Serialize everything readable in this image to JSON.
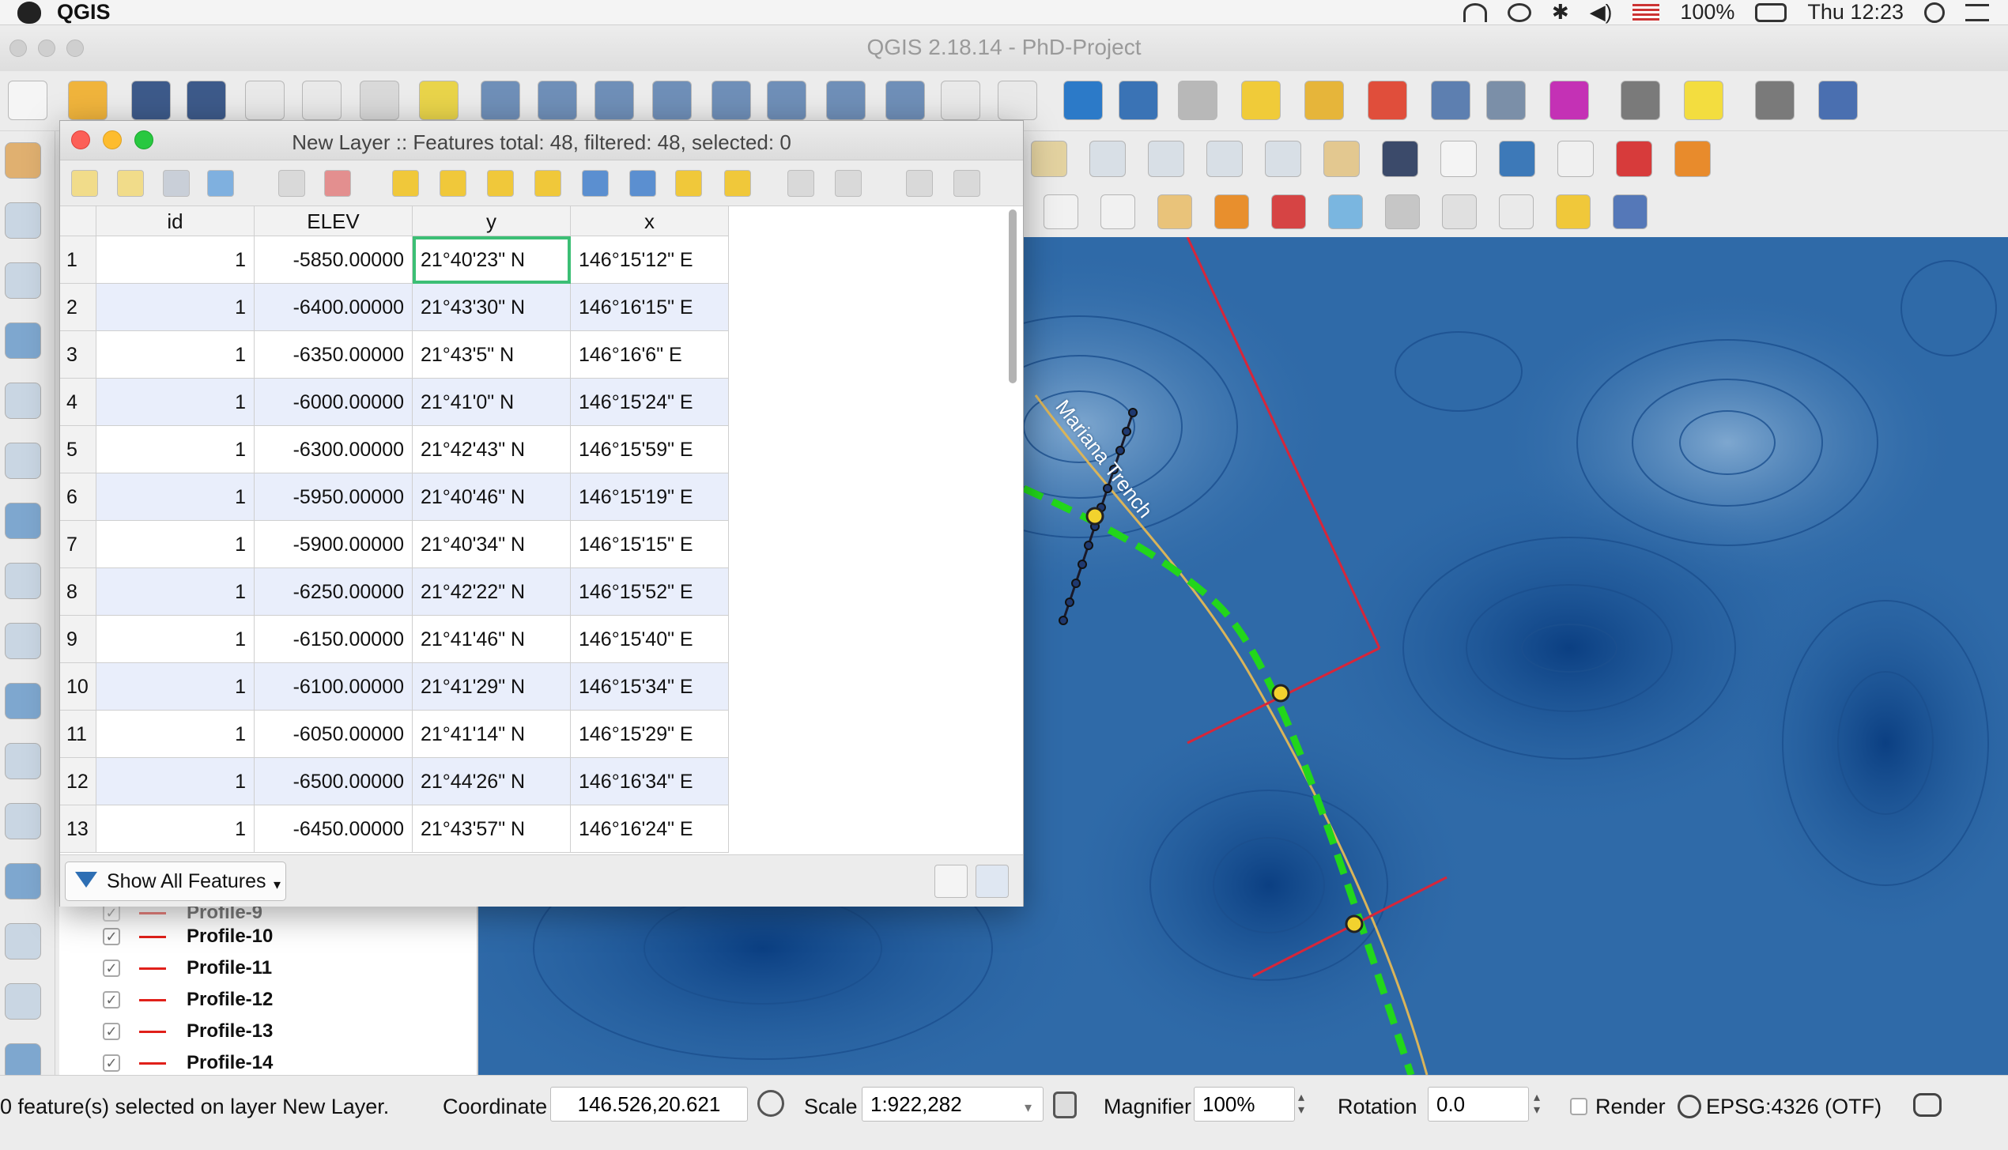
{
  "menubar": {
    "app": "QGIS",
    "battery": "100%",
    "clock": "Thu 12:23"
  },
  "window": {
    "title": "QGIS 2.18.14 - PhD-Project"
  },
  "attribute_table": {
    "title": "New Layer :: Features total: 48, filtered: 48, selected: 0",
    "columns": [
      "id",
      "ELEV",
      "y",
      "x"
    ],
    "rows": [
      {
        "n": "1",
        "id": "1",
        "elev": "-5850.00000",
        "y": "21°40'23\" N",
        "x": "146°15'12\" E"
      },
      {
        "n": "2",
        "id": "1",
        "elev": "-6400.00000",
        "y": "21°43'30\" N",
        "x": "146°16'15\" E"
      },
      {
        "n": "3",
        "id": "1",
        "elev": "-6350.00000",
        "y": "21°43'5\" N",
        "x": "146°16'6\" E"
      },
      {
        "n": "4",
        "id": "1",
        "elev": "-6000.00000",
        "y": "21°41'0\" N",
        "x": "146°15'24\" E"
      },
      {
        "n": "5",
        "id": "1",
        "elev": "-6300.00000",
        "y": "21°42'43\" N",
        "x": "146°15'59\" E"
      },
      {
        "n": "6",
        "id": "1",
        "elev": "-5950.00000",
        "y": "21°40'46\" N",
        "x": "146°15'19\" E"
      },
      {
        "n": "7",
        "id": "1",
        "elev": "-5900.00000",
        "y": "21°40'34\" N",
        "x": "146°15'15\" E"
      },
      {
        "n": "8",
        "id": "1",
        "elev": "-6250.00000",
        "y": "21°42'22\" N",
        "x": "146°15'52\" E"
      },
      {
        "n": "9",
        "id": "1",
        "elev": "-6150.00000",
        "y": "21°41'46\" N",
        "x": "146°15'40\" E"
      },
      {
        "n": "10",
        "id": "1",
        "elev": "-6100.00000",
        "y": "21°41'29\" N",
        "x": "146°15'34\" E"
      },
      {
        "n": "11",
        "id": "1",
        "elev": "-6050.00000",
        "y": "21°41'14\" N",
        "x": "146°15'29\" E"
      },
      {
        "n": "12",
        "id": "1",
        "elev": "-6500.00000",
        "y": "21°44'26\" N",
        "x": "146°16'34\" E"
      },
      {
        "n": "13",
        "id": "1",
        "elev": "-6450.00000",
        "y": "21°43'57\" N",
        "x": "146°16'24\" E"
      }
    ],
    "filter_button": "Show All Features"
  },
  "layers_panel": {
    "items": [
      "Profile-9",
      "Profile-10",
      "Profile-11",
      "Profile-12",
      "Profile-13",
      "Profile-14"
    ]
  },
  "map": {
    "label": "Mariana Trench"
  },
  "statusbar": {
    "message": "0 feature(s) selected on layer New Layer.",
    "coordinate_label": "Coordinate",
    "coordinate_value": "146.526,20.621",
    "scale_label": "Scale",
    "scale_value": "1:922,282",
    "magnifier_label": "Magnifier",
    "magnifier_value": "100%",
    "rotation_label": "Rotation",
    "rotation_value": "0.0",
    "render_label": "Render",
    "crs": "EPSG:4326 (OTF)"
  },
  "toolbar_icons": [
    "new-project-icon",
    "open-project-icon",
    "save-project-icon",
    "save-as-icon",
    "new-print-composer-icon",
    "composer-manager-icon",
    "pan-icon",
    "pan-to-selection-icon",
    "zoom-in-icon",
    "zoom-out-icon",
    "zoom-native-icon",
    "zoom-full-icon",
    "zoom-to-selection-icon",
    "zoom-to-layer-icon",
    "zoom-last-icon",
    "zoom-next-icon",
    "new-map-view-icon",
    "new-bookmark-icon",
    "refresh-icon",
    "identify-icon",
    "action-icon",
    "select-feature-icon",
    "select-by-value-icon",
    "deselect-icon",
    "attribute-table-icon",
    "field-calculator-icon",
    "statistics-icon",
    "measure-icon",
    "map-tips-icon",
    "text-annotation-icon",
    "help-icon"
  ],
  "colors": {
    "map_water": "#2d69a8",
    "selection_outline": "#3cbf75",
    "green_route": "#22d61b",
    "profile_line": "#d6263a"
  }
}
